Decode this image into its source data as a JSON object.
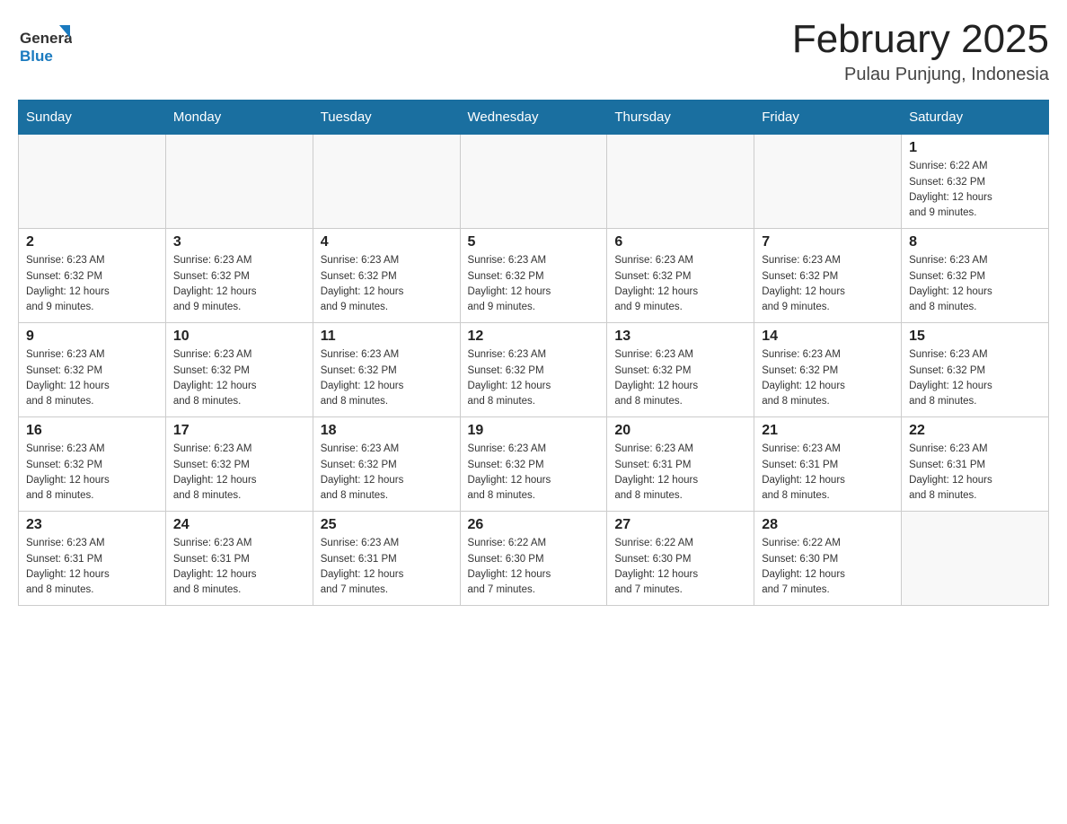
{
  "header": {
    "logo_text_general": "General",
    "logo_text_blue": "Blue",
    "month_title": "February 2025",
    "location": "Pulau Punjung, Indonesia"
  },
  "days_of_week": [
    "Sunday",
    "Monday",
    "Tuesday",
    "Wednesday",
    "Thursday",
    "Friday",
    "Saturday"
  ],
  "weeks": [
    [
      {
        "day": "",
        "info": ""
      },
      {
        "day": "",
        "info": ""
      },
      {
        "day": "",
        "info": ""
      },
      {
        "day": "",
        "info": ""
      },
      {
        "day": "",
        "info": ""
      },
      {
        "day": "",
        "info": ""
      },
      {
        "day": "1",
        "info": "Sunrise: 6:22 AM\nSunset: 6:32 PM\nDaylight: 12 hours\nand 9 minutes."
      }
    ],
    [
      {
        "day": "2",
        "info": "Sunrise: 6:23 AM\nSunset: 6:32 PM\nDaylight: 12 hours\nand 9 minutes."
      },
      {
        "day": "3",
        "info": "Sunrise: 6:23 AM\nSunset: 6:32 PM\nDaylight: 12 hours\nand 9 minutes."
      },
      {
        "day": "4",
        "info": "Sunrise: 6:23 AM\nSunset: 6:32 PM\nDaylight: 12 hours\nand 9 minutes."
      },
      {
        "day": "5",
        "info": "Sunrise: 6:23 AM\nSunset: 6:32 PM\nDaylight: 12 hours\nand 9 minutes."
      },
      {
        "day": "6",
        "info": "Sunrise: 6:23 AM\nSunset: 6:32 PM\nDaylight: 12 hours\nand 9 minutes."
      },
      {
        "day": "7",
        "info": "Sunrise: 6:23 AM\nSunset: 6:32 PM\nDaylight: 12 hours\nand 9 minutes."
      },
      {
        "day": "8",
        "info": "Sunrise: 6:23 AM\nSunset: 6:32 PM\nDaylight: 12 hours\nand 8 minutes."
      }
    ],
    [
      {
        "day": "9",
        "info": "Sunrise: 6:23 AM\nSunset: 6:32 PM\nDaylight: 12 hours\nand 8 minutes."
      },
      {
        "day": "10",
        "info": "Sunrise: 6:23 AM\nSunset: 6:32 PM\nDaylight: 12 hours\nand 8 minutes."
      },
      {
        "day": "11",
        "info": "Sunrise: 6:23 AM\nSunset: 6:32 PM\nDaylight: 12 hours\nand 8 minutes."
      },
      {
        "day": "12",
        "info": "Sunrise: 6:23 AM\nSunset: 6:32 PM\nDaylight: 12 hours\nand 8 minutes."
      },
      {
        "day": "13",
        "info": "Sunrise: 6:23 AM\nSunset: 6:32 PM\nDaylight: 12 hours\nand 8 minutes."
      },
      {
        "day": "14",
        "info": "Sunrise: 6:23 AM\nSunset: 6:32 PM\nDaylight: 12 hours\nand 8 minutes."
      },
      {
        "day": "15",
        "info": "Sunrise: 6:23 AM\nSunset: 6:32 PM\nDaylight: 12 hours\nand 8 minutes."
      }
    ],
    [
      {
        "day": "16",
        "info": "Sunrise: 6:23 AM\nSunset: 6:32 PM\nDaylight: 12 hours\nand 8 minutes."
      },
      {
        "day": "17",
        "info": "Sunrise: 6:23 AM\nSunset: 6:32 PM\nDaylight: 12 hours\nand 8 minutes."
      },
      {
        "day": "18",
        "info": "Sunrise: 6:23 AM\nSunset: 6:32 PM\nDaylight: 12 hours\nand 8 minutes."
      },
      {
        "day": "19",
        "info": "Sunrise: 6:23 AM\nSunset: 6:32 PM\nDaylight: 12 hours\nand 8 minutes."
      },
      {
        "day": "20",
        "info": "Sunrise: 6:23 AM\nSunset: 6:31 PM\nDaylight: 12 hours\nand 8 minutes."
      },
      {
        "day": "21",
        "info": "Sunrise: 6:23 AM\nSunset: 6:31 PM\nDaylight: 12 hours\nand 8 minutes."
      },
      {
        "day": "22",
        "info": "Sunrise: 6:23 AM\nSunset: 6:31 PM\nDaylight: 12 hours\nand 8 minutes."
      }
    ],
    [
      {
        "day": "23",
        "info": "Sunrise: 6:23 AM\nSunset: 6:31 PM\nDaylight: 12 hours\nand 8 minutes."
      },
      {
        "day": "24",
        "info": "Sunrise: 6:23 AM\nSunset: 6:31 PM\nDaylight: 12 hours\nand 8 minutes."
      },
      {
        "day": "25",
        "info": "Sunrise: 6:23 AM\nSunset: 6:31 PM\nDaylight: 12 hours\nand 7 minutes."
      },
      {
        "day": "26",
        "info": "Sunrise: 6:22 AM\nSunset: 6:30 PM\nDaylight: 12 hours\nand 7 minutes."
      },
      {
        "day": "27",
        "info": "Sunrise: 6:22 AM\nSunset: 6:30 PM\nDaylight: 12 hours\nand 7 minutes."
      },
      {
        "day": "28",
        "info": "Sunrise: 6:22 AM\nSunset: 6:30 PM\nDaylight: 12 hours\nand 7 minutes."
      },
      {
        "day": "",
        "info": ""
      }
    ]
  ]
}
